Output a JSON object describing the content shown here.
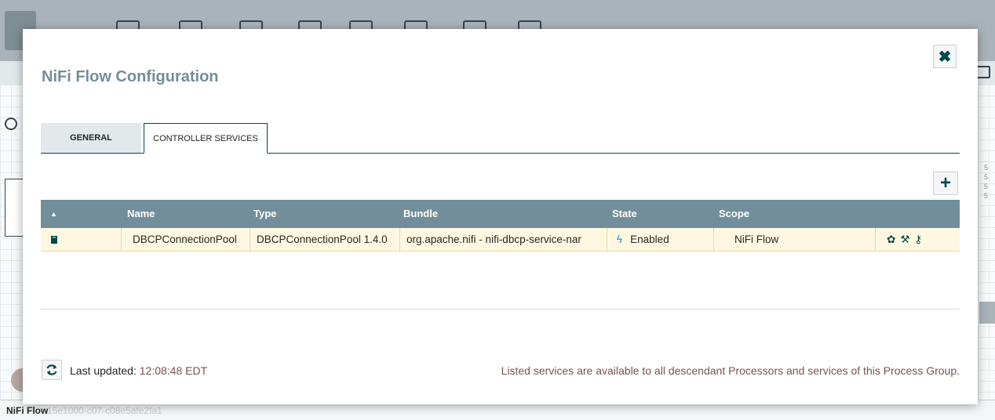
{
  "background": {
    "footer_label": "NiFi Flow",
    "footer_group_id": "15e1000-c07-c08e5afe2fa1",
    "side_numbers": [
      "5",
      "5",
      "5",
      "5"
    ]
  },
  "dialog": {
    "title": "NiFi Flow Configuration",
    "close_icon": "close-icon",
    "tabs": [
      {
        "label": "GENERAL",
        "selected": false
      },
      {
        "label": "CONTROLLER SERVICES",
        "selected": true
      }
    ],
    "add_icon": "plus-icon"
  },
  "table": {
    "columns": [
      "Name",
      "Type",
      "Bundle",
      "State",
      "Scope"
    ],
    "sort_indicator": "▲",
    "rows": [
      {
        "name": "DBCPConnectionPool",
        "type": "DBCPConnectionPool 1.4.0",
        "bundle": "org.apache.nifi - nifi-dbcp-service-nar",
        "state": "Enabled",
        "scope": "NiFi Flow",
        "row_icon": "book-icon",
        "state_icon": "lightning-icon",
        "actions": [
          "gear-icon",
          "disable-icon",
          "key-icon"
        ]
      }
    ]
  },
  "footer": {
    "last_updated_label": "Last updated:",
    "last_updated_time": "12:08:48 EDT",
    "scope_note": "Listed services are available to all descendant Processors and services of this Process Group."
  },
  "colors": {
    "accent": "#004849",
    "header_bg": "#728e9b",
    "row_bg": "#fff8e1",
    "highlight_text": "#775351"
  }
}
